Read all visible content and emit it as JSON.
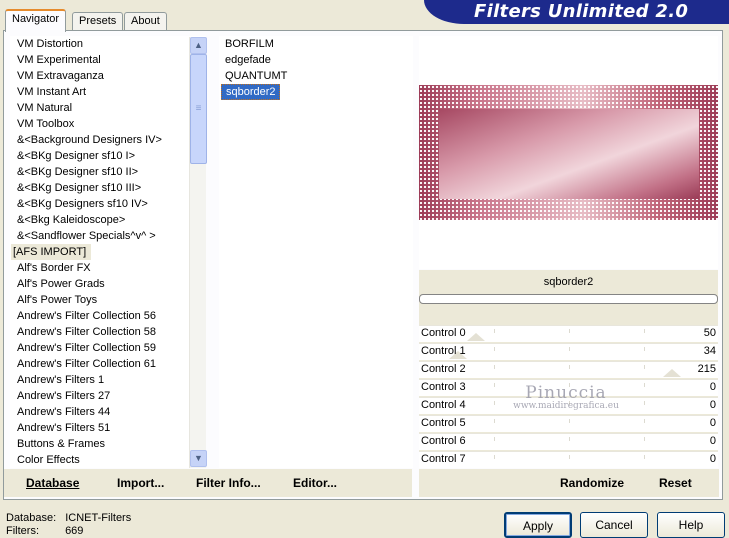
{
  "app_title": "Filters Unlimited 2.0",
  "tabs": [
    "Navigator",
    "Presets",
    "About"
  ],
  "categories": [
    "VM Distortion",
    "VM Experimental",
    "VM Extravaganza",
    "VM Instant Art",
    "VM Natural",
    "VM Toolbox",
    "&<Background Designers IV>",
    "&<BKg Designer sf10 I>",
    "&<BKg Designer sf10 II>",
    "&<BKg Designer sf10 III>",
    "&<BKg Designers sf10 IV>",
    "&<Bkg Kaleidoscope>",
    "&<Sandflower Specials^v^ >",
    "[AFS IMPORT]",
    "Alf's Border FX",
    "Alf's Power Grads",
    "Alf's Power Toys",
    "Andrew's Filter Collection 56",
    "Andrew's Filter Collection 58",
    "Andrew's Filter Collection 59",
    "Andrew's Filter Collection 61",
    "Andrew's Filters 1",
    "Andrew's Filters 27",
    "Andrew's Filters 44",
    "Andrew's Filters 51",
    "Buttons & Frames",
    "Color Effects"
  ],
  "selected_category": "[AFS IMPORT]",
  "filters": [
    "BORFILM",
    "edgefade",
    "QUANTUMT",
    "sqborder2"
  ],
  "selected_filter": "sqborder2",
  "preview_filter_name": "sqborder2",
  "controls": [
    {
      "label": "Control 0",
      "value": "50"
    },
    {
      "label": "Control 1",
      "value": "34"
    },
    {
      "label": "Control 2",
      "value": "215"
    },
    {
      "label": "Control 3",
      "value": "0"
    },
    {
      "label": "Control 4",
      "value": "0"
    },
    {
      "label": "Control 5",
      "value": "0"
    },
    {
      "label": "Control 6",
      "value": "0"
    },
    {
      "label": "Control 7",
      "value": "0"
    }
  ],
  "toolbar": {
    "database": "Database",
    "import": "Import...",
    "filter_info": "Filter Info...",
    "editor": "Editor...",
    "randomize": "Randomize",
    "reset": "Reset"
  },
  "info": {
    "database_label": "Database:",
    "database_value": "ICNET-Filters",
    "filters_label": "Filters:",
    "filters_value": "669"
  },
  "buttons": {
    "apply": "Apply",
    "cancel": "Cancel",
    "help": "Help"
  },
  "watermark": {
    "line1": "Pinuccia",
    "line2": "www.maidiregrafica.eu"
  },
  "colors": {
    "banner": "#1d2a8c",
    "selection": "#316ac5"
  }
}
